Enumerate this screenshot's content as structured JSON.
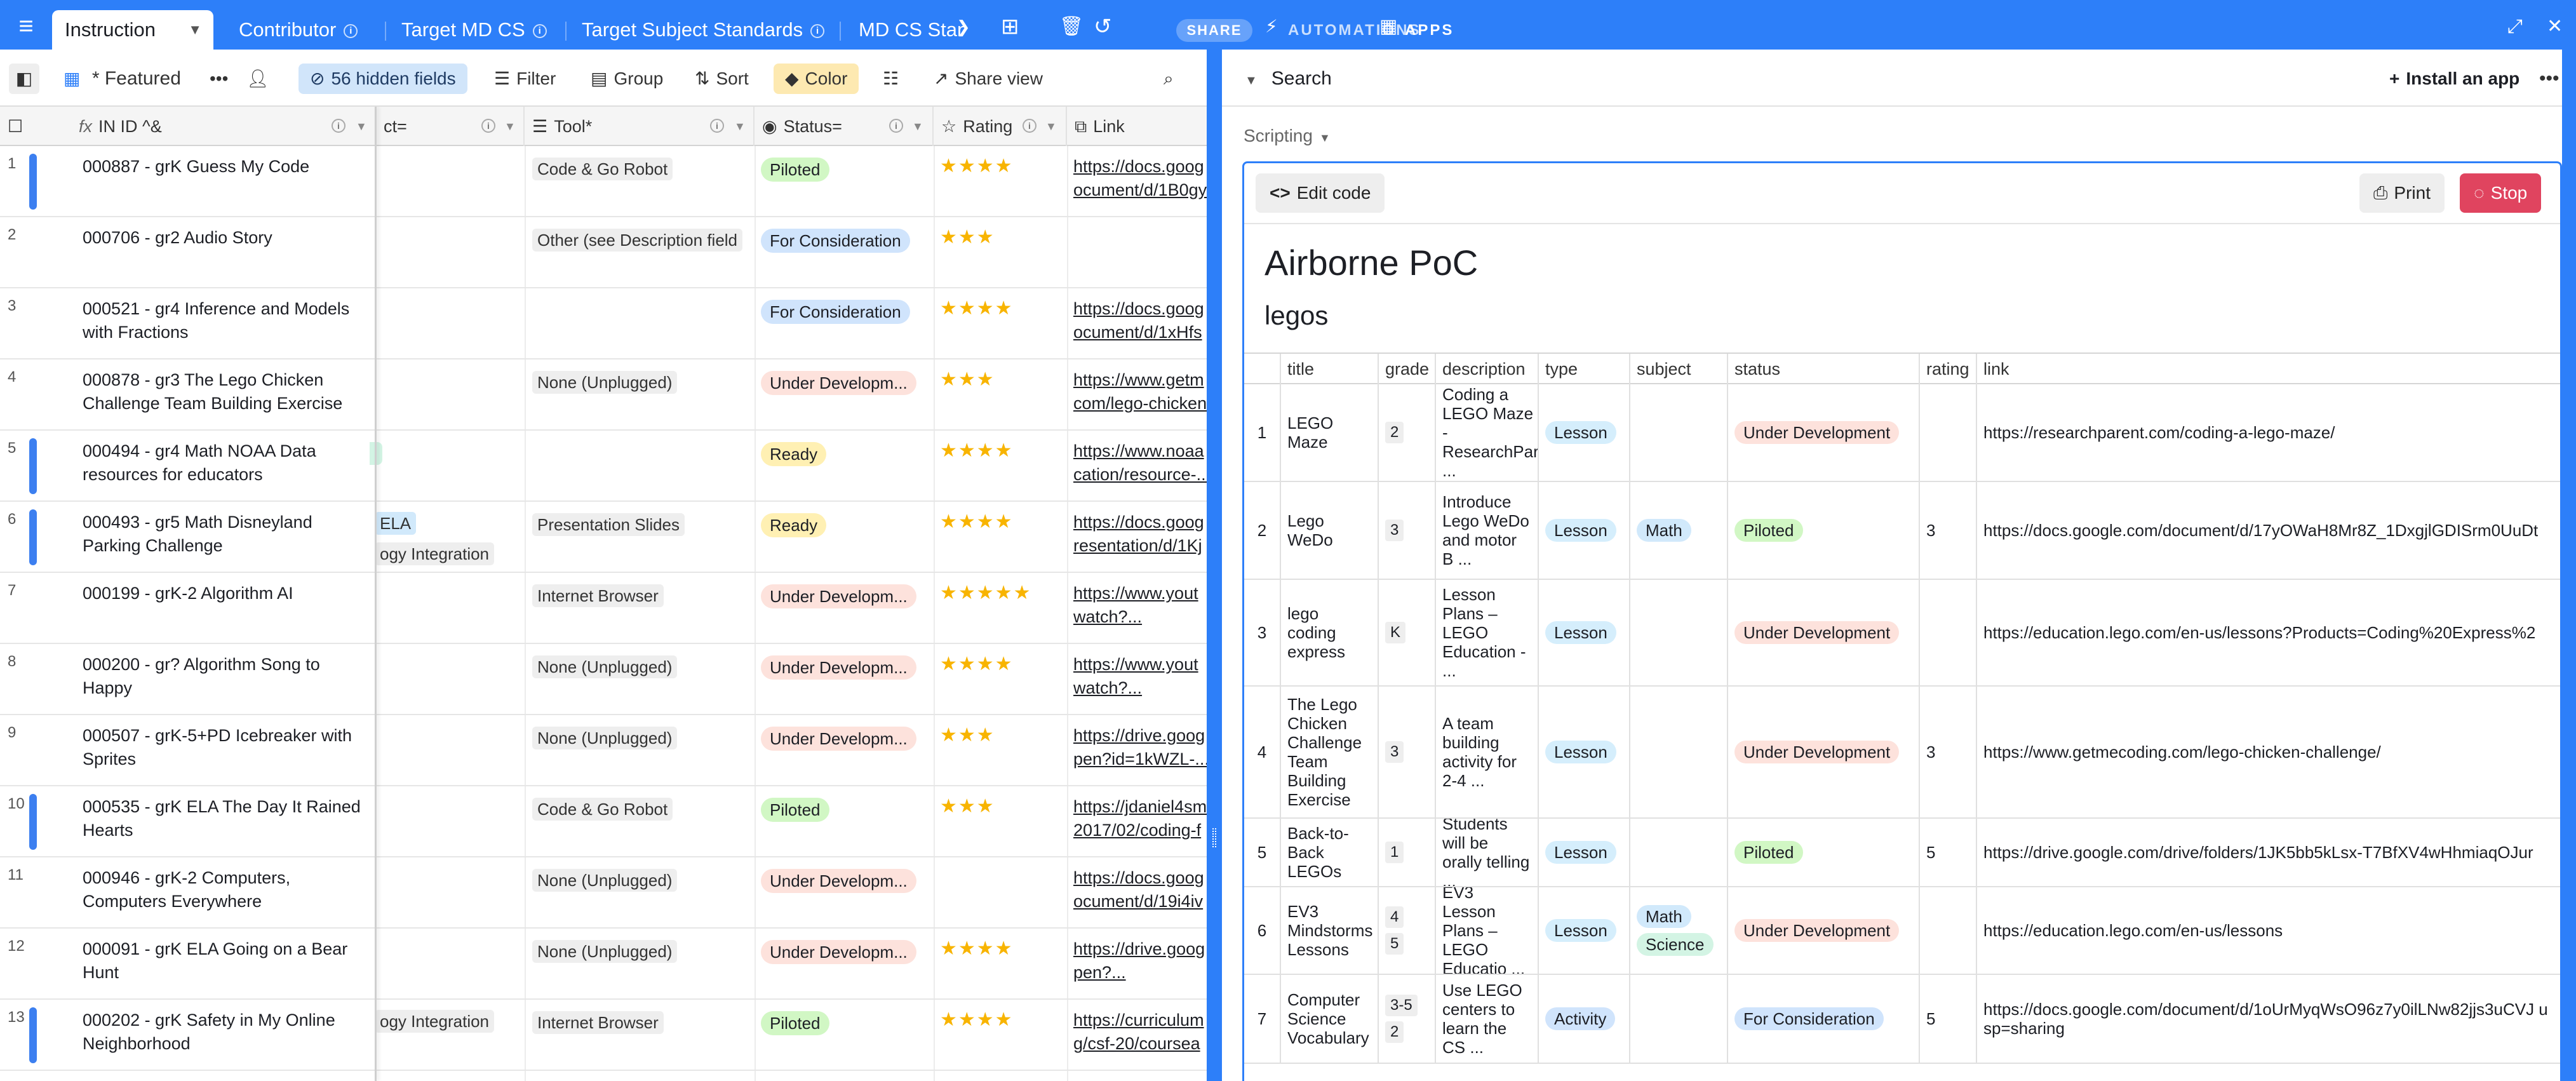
{
  "topbar": {
    "tabs": [
      {
        "label": "Instruction",
        "active": true
      },
      {
        "label": "Contributor"
      },
      {
        "label": "Target MD CS"
      },
      {
        "label": "Target Subject Standards"
      },
      {
        "label": "MD CS Stan"
      }
    ],
    "share_label": "SHARE",
    "automations_label": "AUTOMATIONS",
    "apps_label": "APPS"
  },
  "toolbar": {
    "view_name": "* Featured",
    "hidden_fields": "56 hidden fields",
    "filter": "Filter",
    "group": "Group",
    "sort": "Sort",
    "color": "Color",
    "share_view": "Share view"
  },
  "grid": {
    "columns": {
      "primary": "IN ID ^&",
      "subject": "ct=",
      "tool": "Tool*",
      "status": "Status=",
      "rating": "Rating",
      "link": "Link"
    },
    "rows": [
      {
        "n": "1",
        "title": "000887 - grK Guess My Code",
        "bar": true,
        "tool": "Code & Go Robot",
        "status": "Piloted",
        "stars": "★★★★",
        "link1": "https://docs.goog",
        "link2": "ocument/d/1B0gy"
      },
      {
        "n": "2",
        "title": "000706 - gr2 Audio Story",
        "bar": false,
        "tool": "Other (see Description field",
        "status": "For Consideration",
        "stars": "★★★",
        "link1": "",
        "link2": ""
      },
      {
        "n": "3",
        "title": "000521 - gr4 Inference and Models with Fractions",
        "bar": false,
        "tool": "",
        "status": "For Consideration",
        "stars": "★★★★",
        "link1": "https://docs.goog",
        "link2": "ocument/d/1xHfs"
      },
      {
        "n": "4",
        "title": "000878 - gr3 The Lego Chicken Challenge Team Building Exercise",
        "bar": false,
        "tool": "None (Unplugged)",
        "status": "Under Developm...",
        "stars": "★★★",
        "link1": "https://www.getm",
        "link2": "com/lego-chicken"
      },
      {
        "n": "5",
        "title": "000494 - gr4 Math NOAA  Data resources for educators",
        "bar": true,
        "tool": "",
        "status": "Ready",
        "stars": "★★★★",
        "link1": "https://www.noaa",
        "link2": "cation/resource-..."
      },
      {
        "n": "6",
        "title": "000493 - gr5 Math Disneyland Parking Challenge",
        "bar": true,
        "tool": "Presentation Slides",
        "status": "Ready",
        "stars": "★★★★",
        "link1": "https://docs.goog",
        "link2": "resentation/d/1Kj"
      },
      {
        "n": "7",
        "title": "000199 - grK-2 Algorithm AI",
        "bar": false,
        "tool": "Internet Browser",
        "status": "Under Developm...",
        "stars": "★★★★★",
        "link1": "https://www.yout",
        "link2": "watch?..."
      },
      {
        "n": "8",
        "title": "000200 - gr? Algorithm Song to Happy",
        "bar": false,
        "tool": "None (Unplugged)",
        "status": "Under Developm...",
        "stars": "★★★★",
        "link1": "https://www.yout",
        "link2": "watch?..."
      },
      {
        "n": "9",
        "title": "000507 - grK-5+PD Icebreaker with Sprites",
        "bar": false,
        "tool": "None (Unplugged)",
        "status": "Under Developm...",
        "stars": "★★★",
        "link1": "https://drive.goog",
        "link2": "pen?id=1kWZL-..."
      },
      {
        "n": "10",
        "title": "000535 - grK ELA The Day It Rained Hearts",
        "bar": true,
        "tool": "Code & Go Robot",
        "status": "Piloted",
        "stars": "★★★",
        "link1": "https://jdaniel4sm",
        "link2": "2017/02/coding-f"
      },
      {
        "n": "11",
        "title": "000946 - grK-2 Computers, Computers Everywhere",
        "bar": false,
        "tool": "None (Unplugged)",
        "status": "Under Developm...",
        "stars": "",
        "link1": "https://docs.goog",
        "link2": "ocument/d/19i4iv"
      },
      {
        "n": "12",
        "title": "000091 - grK ELA Going on a Bear Hunt",
        "bar": false,
        "tool": "None (Unplugged)",
        "status": "Under Developm...",
        "stars": "★★★★",
        "link1": "https://drive.goog",
        "link2": "pen?..."
      },
      {
        "n": "13",
        "title": "000202 - grK Safety in My Online Neighborhood",
        "bar": true,
        "tool": "Internet Browser",
        "status": "Piloted",
        "stars": "★★★★",
        "link1": "https://curriculum",
        "link2": "g/csf-20/coursea"
      }
    ],
    "subject_tags": {
      "row6_a": "ELA",
      "row6_b": "ogy Integration",
      "row13": "ogy Integration"
    }
  },
  "app": {
    "title": "Search",
    "install": "Install an app",
    "scripting": "Scripting",
    "edit_code": "Edit code",
    "print": "Print",
    "stop": "Stop",
    "heading": "Airborne PoC",
    "subheading": "legos",
    "table": {
      "headers": [
        "title",
        "grade",
        "description",
        "type",
        "subject",
        "status",
        "rating",
        "link"
      ],
      "rows": [
        {
          "n": "1",
          "title": "LEGO Maze",
          "grades": [
            "2"
          ],
          "description": "Coding a LEGO Maze - ResearchPar ...",
          "type": "Lesson",
          "subjects": [],
          "status": "Under Development",
          "rating": "",
          "link": "https://researchparent.com/coding-a-lego-maze/"
        },
        {
          "n": "2",
          "title": "Lego WeDo",
          "grades": [
            "3"
          ],
          "description": "Introduce Lego WeDo and motor B ...",
          "type": "Lesson",
          "subjects": [
            "Math"
          ],
          "status": "Piloted",
          "rating": "3",
          "link": "https://docs.google.com/document/d/17yOWaH8Mr8Z_1DxgjlGDISrm0UuDt"
        },
        {
          "n": "3",
          "title": "lego coding express",
          "grades": [
            "K"
          ],
          "description": "Lesson Plans – LEGO Education - ...",
          "type": "Lesson",
          "subjects": [],
          "status": "Under Development",
          "rating": "",
          "link": "https://education.lego.com/en-us/lessons?Products=Coding%20Express%2"
        },
        {
          "n": "4",
          "title": "The Lego Chicken Challenge Team Building Exercise",
          "grades": [
            "3"
          ],
          "description": "A team building activity for 2-4 ...",
          "type": "Lesson",
          "subjects": [],
          "status": "Under Development",
          "rating": "3",
          "link": "https://www.getmecoding.com/lego-chicken-challenge/"
        },
        {
          "n": "5",
          "title": "Back-to-Back LEGOs",
          "grades": [
            "1"
          ],
          "description": "Students will be orally telling ...",
          "type": "Lesson",
          "subjects": [],
          "status": "Piloted",
          "rating": "5",
          "link": "https://drive.google.com/drive/folders/1JK5bb5kLsx-T7BfXV4wHhmiaqOJur"
        },
        {
          "n": "6",
          "title": "EV3 Mindstorms Lessons",
          "grades": [
            "4",
            "5"
          ],
          "description": "EV3 Lesson Plans – LEGO Educatio ...",
          "type": "Lesson",
          "subjects": [
            "Math",
            "Science"
          ],
          "status": "Under Development",
          "rating": "",
          "link": "https://education.lego.com/en-us/lessons"
        },
        {
          "n": "7",
          "title": "Computer Science Vocabulary",
          "grades": [
            "3-5",
            "2"
          ],
          "description": "Use LEGO centers to learn the CS ...",
          "type": "Activity",
          "subjects": [],
          "status": "For Consideration",
          "rating": "5",
          "link": "https://docs.google.com/document/d/1oUrMyqWsO96z7y0ilLNw82jjs3uCVJ usp=sharing"
        }
      ]
    }
  },
  "colors": {
    "accent": "#2d7ff9",
    "piloted": "#d1f7c4",
    "for_consideration": "#d0e4fc",
    "under_development": "#fde2dc",
    "ready": "#fff0b3",
    "lesson": "#d5eefc",
    "activity": "#d0e4fc",
    "math": "#d1e9fb",
    "science": "#d3f4e4",
    "stop": "#e0445f"
  }
}
